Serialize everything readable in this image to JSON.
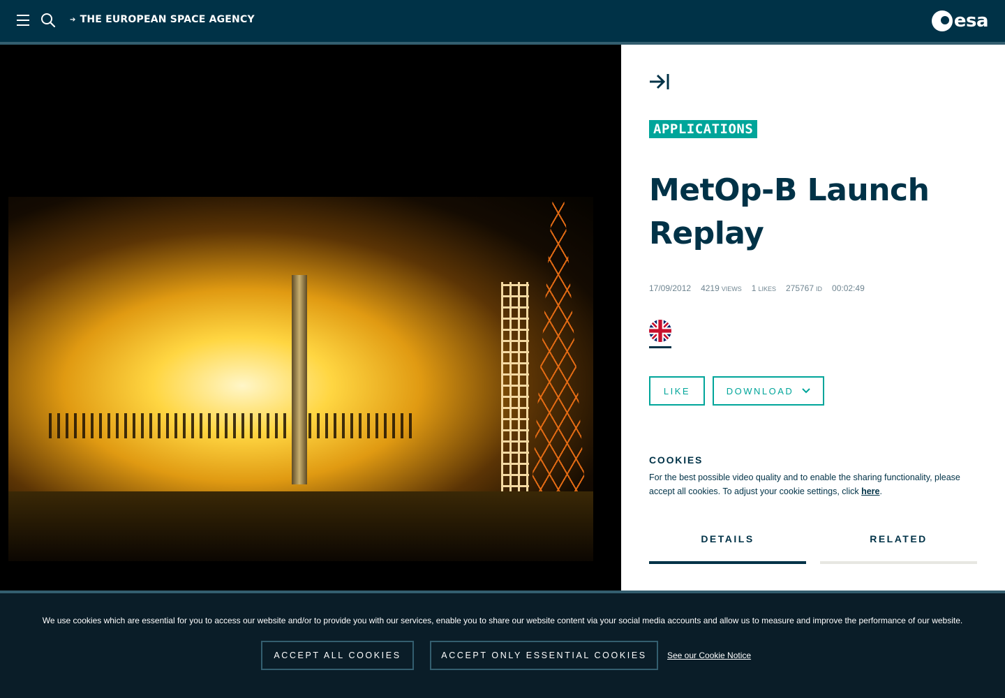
{
  "header": {
    "brand_link": "THE EUROPEAN SPACE AGENCY",
    "logo_text": "esa"
  },
  "media": {
    "category": "APPLICATIONS",
    "title": "MetOp-B Launch Replay",
    "meta": {
      "date": "17/09/2012",
      "views_value": "4219",
      "views_label": "VIEWS",
      "likes_value": "1",
      "likes_label": "LIKES",
      "id_value": "275767",
      "id_label": "ID",
      "duration": "00:02:49"
    },
    "buttons": {
      "like": "LIKE",
      "download": "DOWNLOAD"
    },
    "cookies": {
      "heading": "COOKIES",
      "text": "For the best possible video quality and to enable the sharing functionality, please accept all cookies. To adjust your cookie settings, click ",
      "link": "here",
      "suffix": "."
    },
    "tabs": {
      "details": "DETAILS",
      "related": "RELATED"
    }
  },
  "cookie_banner": {
    "text": "We use cookies which are essential for you to access our website and/or to provide you with our services, enable you to share our website content via your social media accounts and allow us to measure and improve the performance of our website.",
    "accept_all": "ACCEPT ALL COOKIES",
    "accept_essential": "ACCEPT ONLY ESSENTIAL COOKIES",
    "notice_link": "See our Cookie Notice"
  },
  "colors": {
    "header_bg": "#003247",
    "accent": "#00a59a",
    "banner_bg": "#0a1d28"
  },
  "icons": [
    "menu-icon",
    "search-icon",
    "arrow-right-icon",
    "esa-logo",
    "collapse-panel-icon",
    "uk-flag-icon",
    "chevron-down-icon"
  ]
}
